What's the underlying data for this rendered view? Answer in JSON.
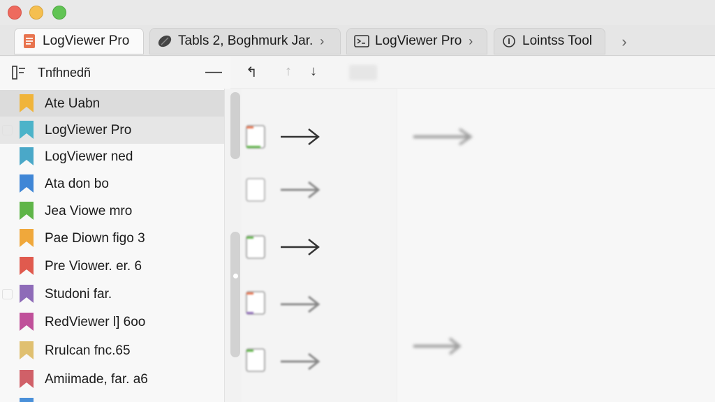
{
  "window": {
    "buttons": [
      "close",
      "minimize",
      "zoom"
    ]
  },
  "tabs": [
    {
      "label": "LogViewer Pro",
      "icon": "document-icon",
      "active": true
    },
    {
      "label": "Tabls 2, Boghmurk Jar.",
      "icon": "pill-icon",
      "active": false
    },
    {
      "label": "LogViewer Pro",
      "icon": "terminal-icon",
      "active": false
    },
    {
      "label": "Lointss Tool",
      "icon": "info-circle-icon",
      "active": false
    }
  ],
  "tab_overflow": "›",
  "sidebar": {
    "title": "Tnfhnedñ",
    "collapse_glyph": "—",
    "items": [
      {
        "label": "Ate Uabn",
        "color": "#f0b43a"
      },
      {
        "label": "LogViewer Pro",
        "color": "#4cb3c9"
      },
      {
        "label": "LogViewer ned",
        "color": "#4aa8c8"
      },
      {
        "label": "Ata don bo",
        "color": "#3f86d6"
      },
      {
        "label": "Jea Viowe mro",
        "color": "#5fb548"
      },
      {
        "label": "Pae Diown figo 3",
        "color": "#f0a83b"
      },
      {
        "label": "Pre Viower. er. 6",
        "color": "#e05a4e"
      },
      {
        "label": "Studoni far.",
        "color": "#8e6bb8"
      },
      {
        "label": "RedViewer l] 6oo",
        "color": "#c0509a"
      },
      {
        "label": "Rrulcan fnc.65",
        "color": "#e0c070"
      },
      {
        "label": "Amiimade, far. a6",
        "color": "#d06068"
      },
      {
        "label": "",
        "color": "#4a90d9"
      }
    ]
  },
  "toolbar": {
    "buttons": [
      {
        "glyph": "↰",
        "icon": "sort-up-icon"
      },
      {
        "glyph": "↑",
        "icon": "arrow-up-icon"
      },
      {
        "glyph": "↓",
        "icon": "arrow-down-icon"
      }
    ]
  },
  "colors": {
    "accent_orange": "#e8744f",
    "traffic_red": "#ee6a5e",
    "traffic_yellow": "#f5bf4f",
    "traffic_green": "#61c454"
  }
}
